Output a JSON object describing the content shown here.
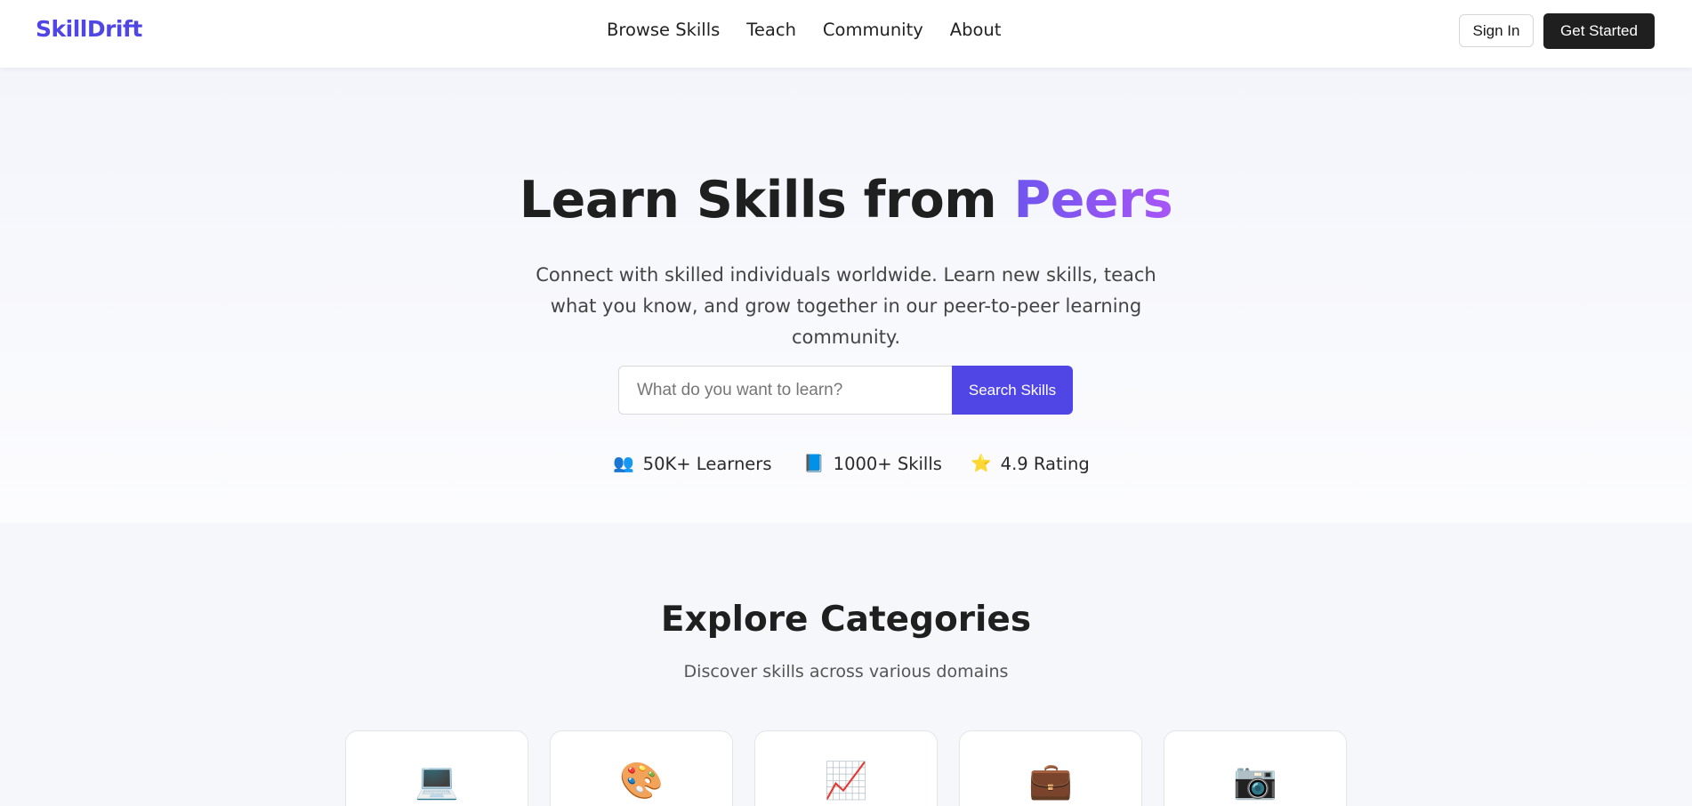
{
  "brand": {
    "name": "SkillDrift",
    "accent_color": "#4f46e5"
  },
  "nav": {
    "links": [
      {
        "label": "Browse Skills"
      },
      {
        "label": "Teach"
      },
      {
        "label": "Community"
      },
      {
        "label": "About"
      }
    ],
    "sign_in_label": "Sign In",
    "get_started_label": "Get Started"
  },
  "hero": {
    "title_main": "Learn Skills from ",
    "title_accent": "Peers",
    "subtitle": "Connect with skilled individuals worldwide. Learn new skills, teach what you know, and grow together in our peer-to-peer learning community.",
    "search": {
      "placeholder": "What do you want to learn?",
      "value": "",
      "button_label": "Search Skills"
    },
    "stats": [
      {
        "icon": "people-icon",
        "glyph": "👥",
        "label": "50K+ Learners"
      },
      {
        "icon": "book-icon",
        "glyph": "📘",
        "label": "1000+ Skills"
      },
      {
        "icon": "star-icon",
        "glyph": "⭐",
        "label": "4.9 Rating"
      }
    ]
  },
  "categories": {
    "title": "Explore Categories",
    "subtitle": "Discover skills across various domains",
    "items": [
      {
        "icon": "laptop-icon",
        "glyph": "💻"
      },
      {
        "icon": "palette-icon",
        "glyph": "🎨"
      },
      {
        "icon": "chart-icon",
        "glyph": "📈"
      },
      {
        "icon": "briefcase-icon",
        "glyph": "💼"
      },
      {
        "icon": "camera-icon",
        "glyph": "📷"
      }
    ]
  }
}
